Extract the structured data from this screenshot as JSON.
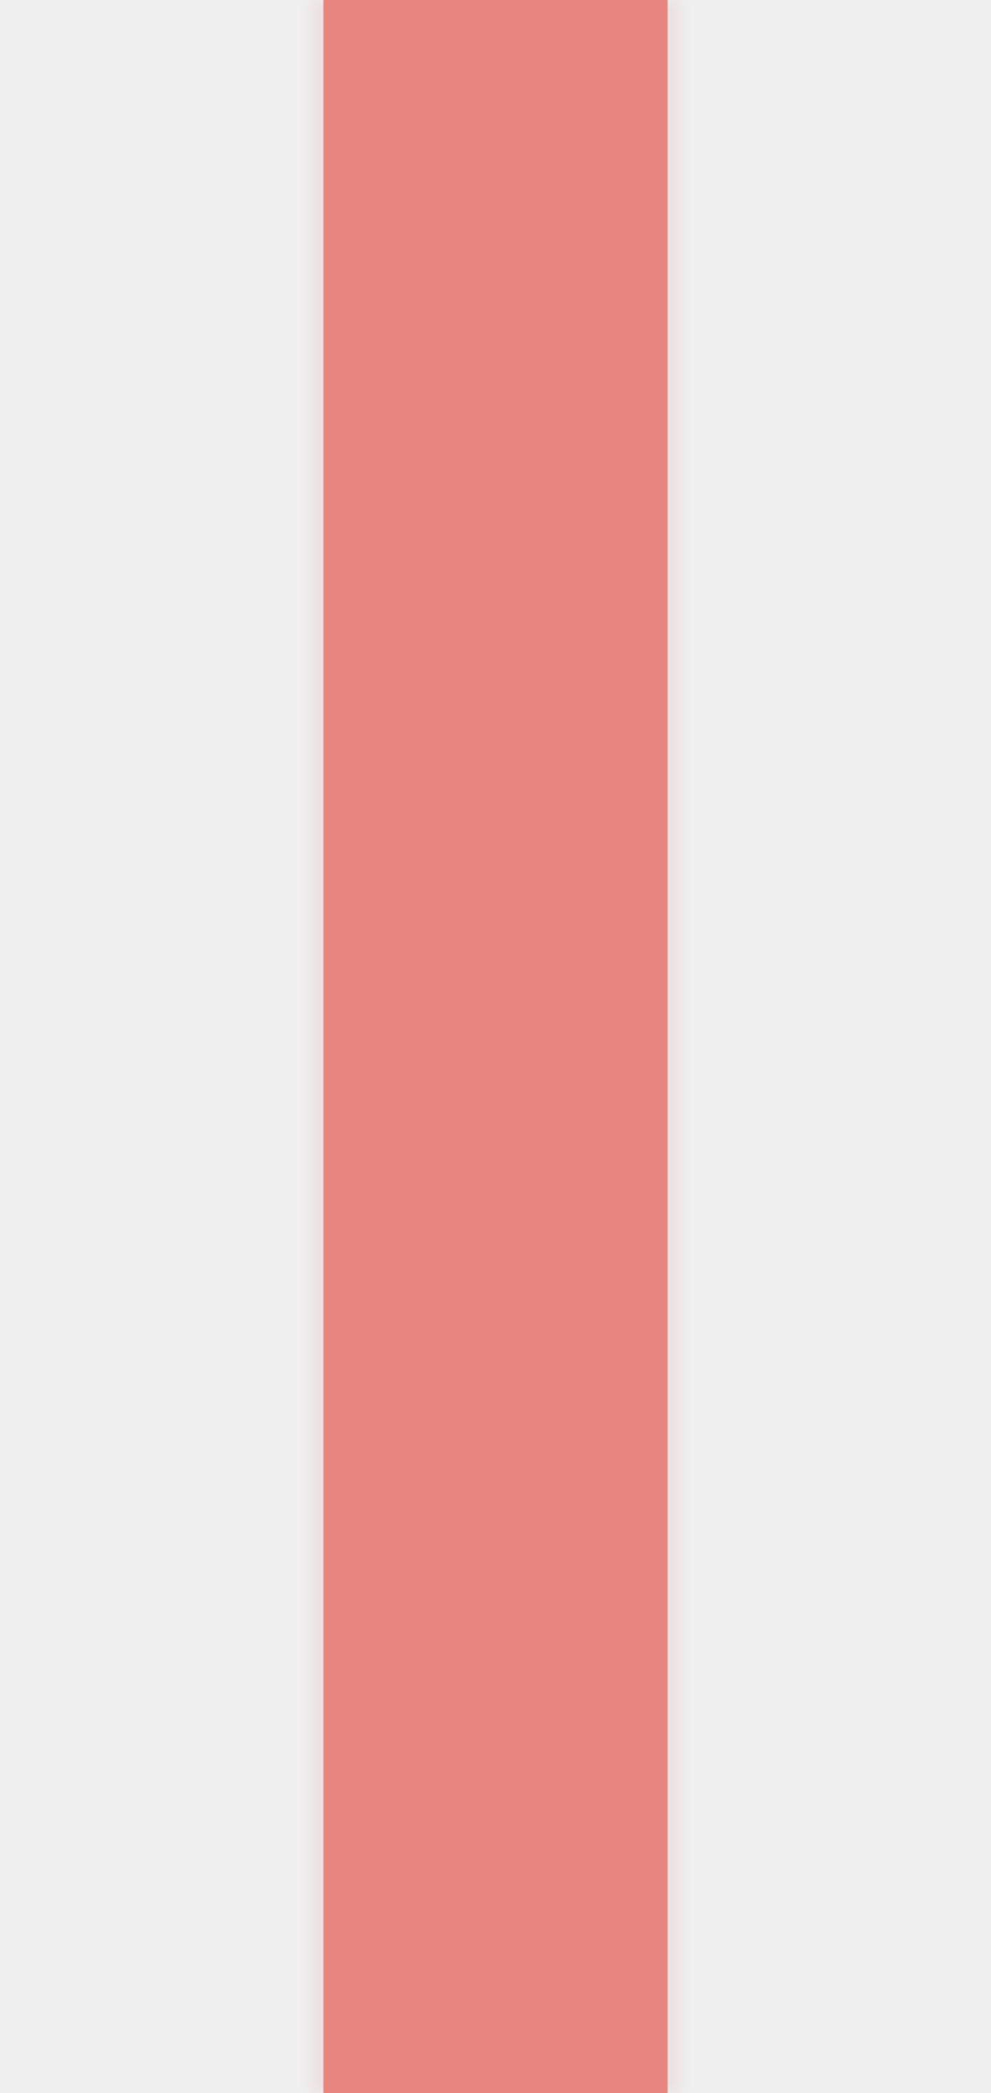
{
  "colors": {
    "background": "#f0f0f0",
    "bar": "#e8877f"
  }
}
